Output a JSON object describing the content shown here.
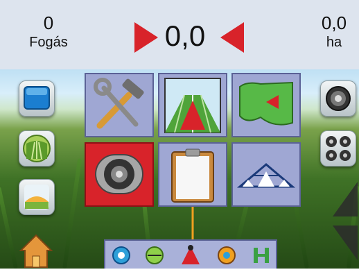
{
  "status": {
    "passes_value": "0",
    "passes_label": "Fogás",
    "speed_value": "0,0",
    "area_value": "0,0",
    "area_unit": "ha"
  },
  "colors": {
    "accent_red": "#d8232a",
    "tile_blue": "#9fa7d3",
    "topbar": "#dde4ee"
  },
  "icons": {
    "left_column": [
      "blank-screen-icon",
      "field-view-icon",
      "horizon-view-icon",
      "home-icon"
    ],
    "right_column": [
      "camera-icon",
      "four-camera-icon",
      "scroll-up-icon",
      "scroll-down-icon"
    ],
    "main_tiles": [
      "tools-icon",
      "guidance-icon",
      "field-map-icon",
      "video-camera-icon",
      "report-clipboard-icon",
      "sprayer-boom-icon"
    ],
    "bottom_bar": [
      "tilt-steer-icon",
      "align-icon",
      "guidance-marker-icon",
      "nav-icon",
      "boom-section-icon"
    ]
  }
}
